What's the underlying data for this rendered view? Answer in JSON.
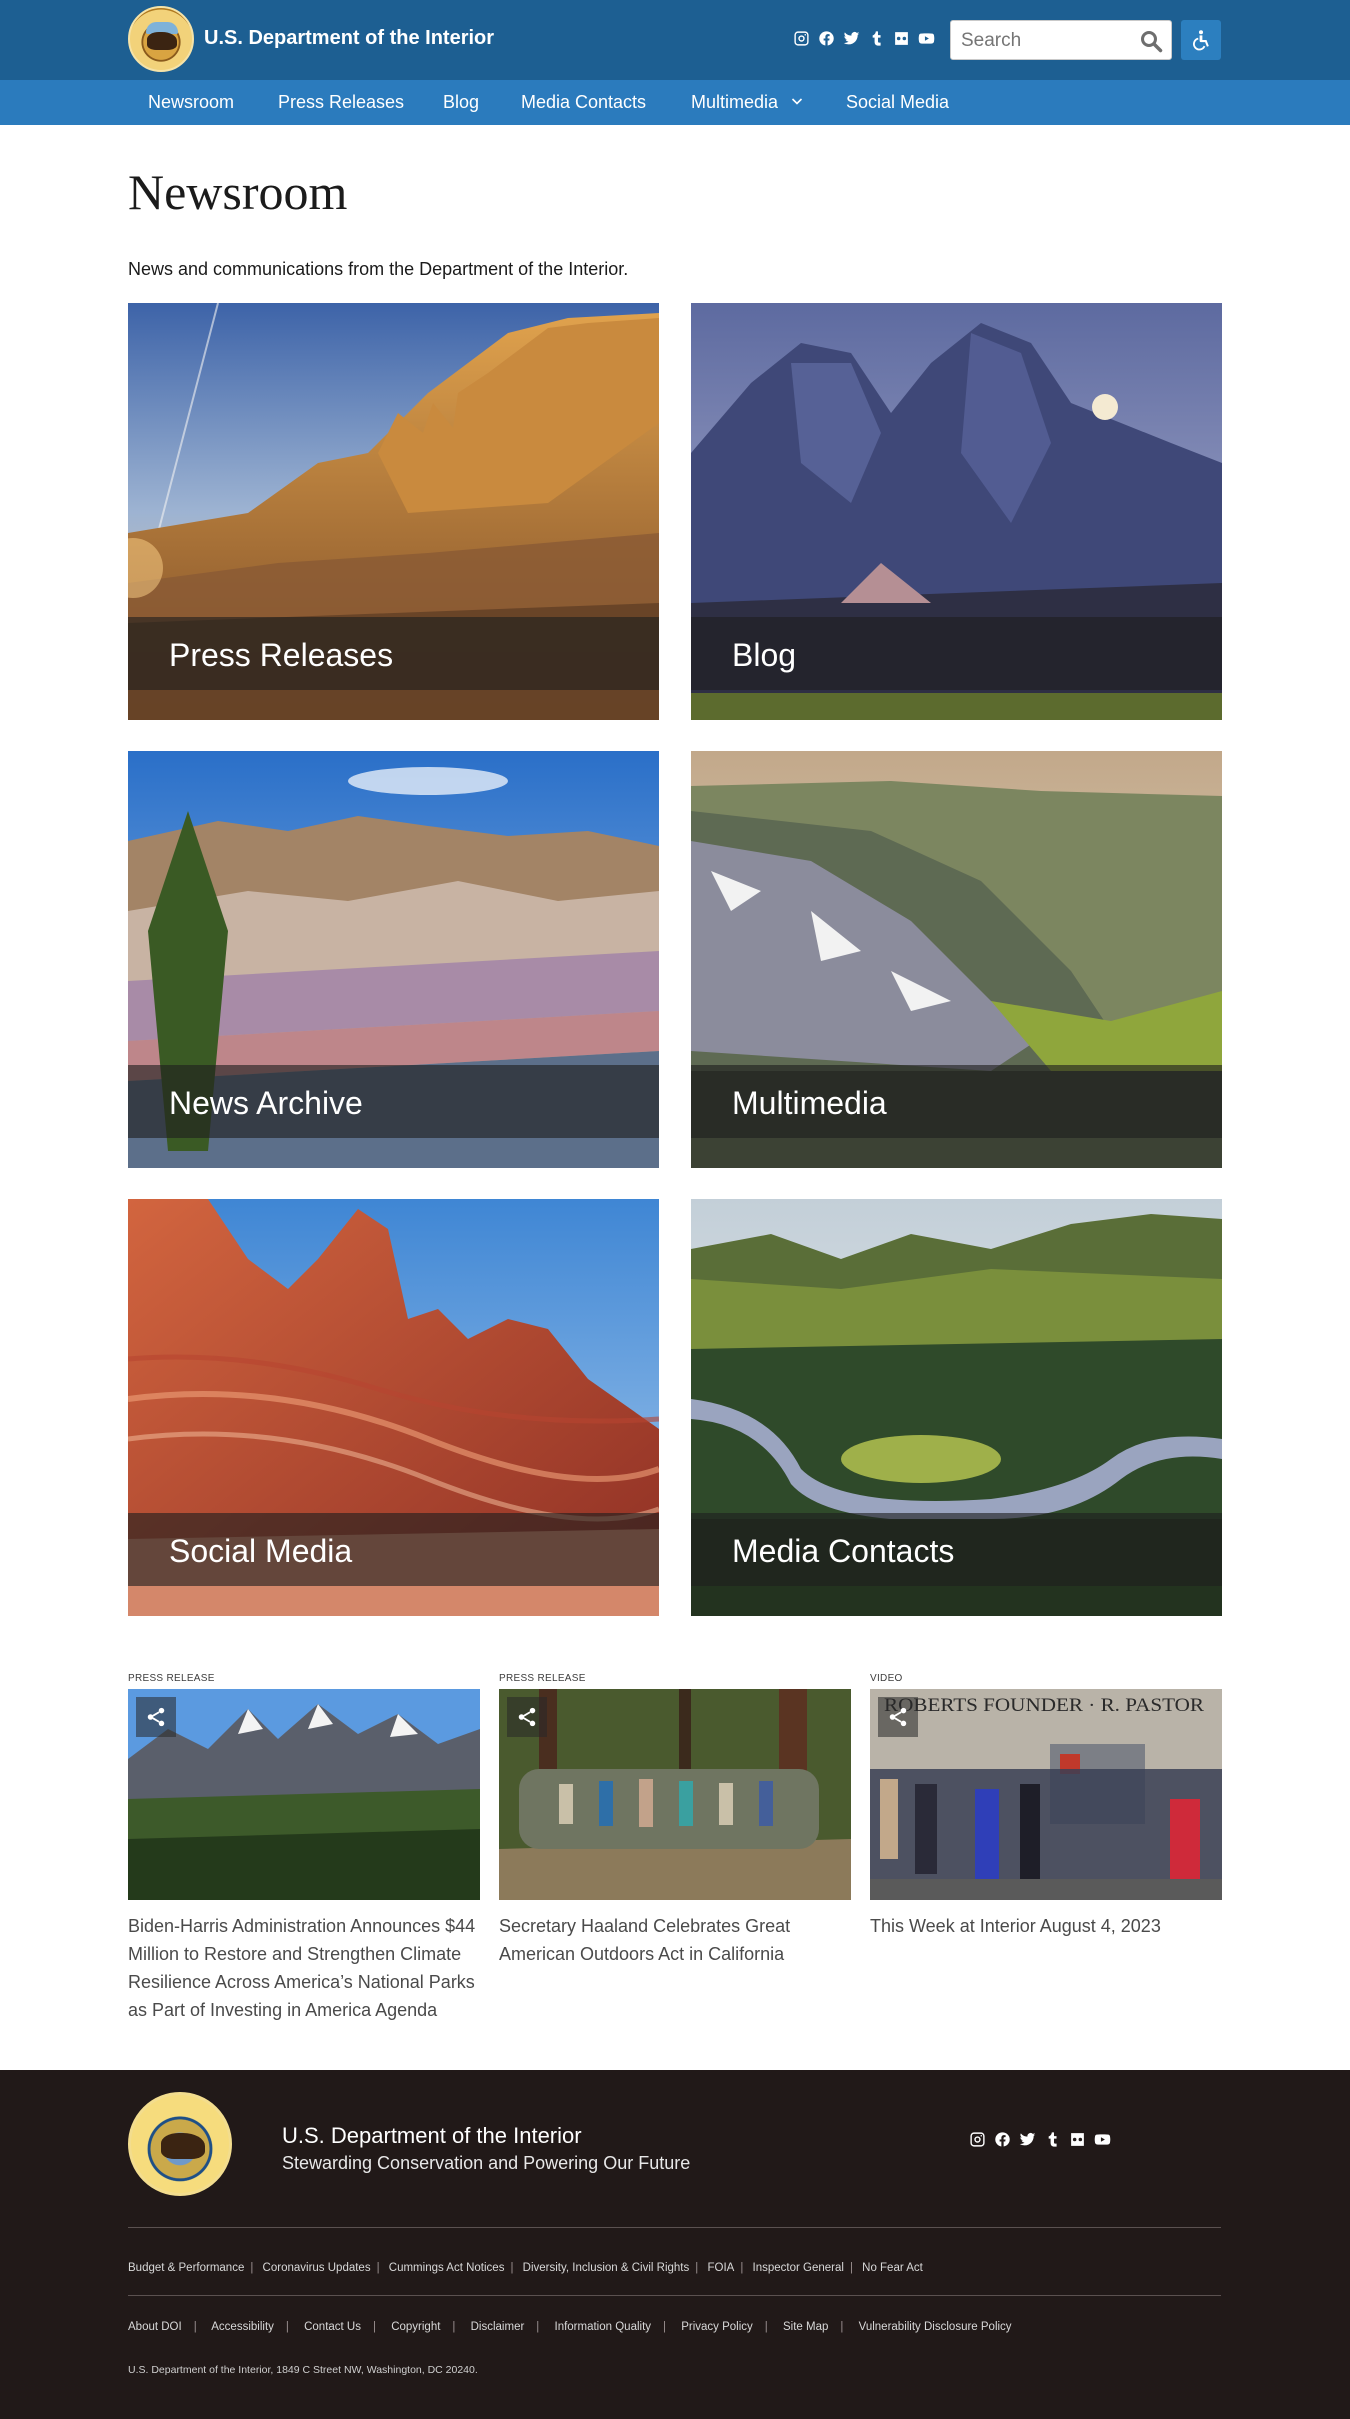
{
  "header": {
    "site_title": "U.S. Department of the Interior",
    "search_placeholder": "Search",
    "social_icons": [
      "instagram-icon",
      "facebook-icon",
      "twitter-icon",
      "tumblr-icon",
      "flickr-icon",
      "youtube-icon"
    ],
    "colors": {
      "topbar": "#1d5f92",
      "navbar": "#2b7bbd"
    }
  },
  "nav": {
    "items": [
      "Newsroom",
      "Press Releases",
      "Blog",
      "Media Contacts",
      "Multimedia",
      "Social Media"
    ]
  },
  "main": {
    "title": "Newsroom",
    "intro": "News and communications from the Department of the Interior.",
    "tiles": [
      "Press Releases",
      "Blog",
      "News Archive",
      "Multimedia",
      "Social Media",
      "Media Contacts"
    ]
  },
  "featured": [
    {
      "kind": "PRESS RELEASE",
      "headline": "Biden-Harris Administration Announces $44 Million to Restore and Strengthen Climate Resilience Across America’s National Parks as Part of Investing in America Agenda"
    },
    {
      "kind": "PRESS RELEASE",
      "headline": "Secretary Haaland Celebrates Great American Outdoors Act in California"
    },
    {
      "kind": "VIDEO",
      "headline": "This Week at Interior August 4, 2023",
      "image_sign_text": "ROBERTS FOUNDER · R. PASTOR"
    }
  ],
  "footer": {
    "org": "U.S. Department of the Interior",
    "tagline": "Stewarding Conservation and Powering Our Future",
    "links_primary": [
      "Budget & Performance",
      "Coronavirus Updates",
      "Cummings Act Notices",
      "Diversity, Inclusion & Civil Rights",
      "FOIA",
      "Inspector General",
      "No Fear Act"
    ],
    "links_secondary": [
      "About DOI",
      "Accessibility",
      "Contact Us",
      "Copyright",
      "Disclaimer",
      "Information Quality",
      "Privacy Policy",
      "Site Map",
      "Vulnerability Disclosure Policy"
    ],
    "address": "U.S. Department of the Interior, 1849 C Street NW, Washington, DC 20240."
  }
}
